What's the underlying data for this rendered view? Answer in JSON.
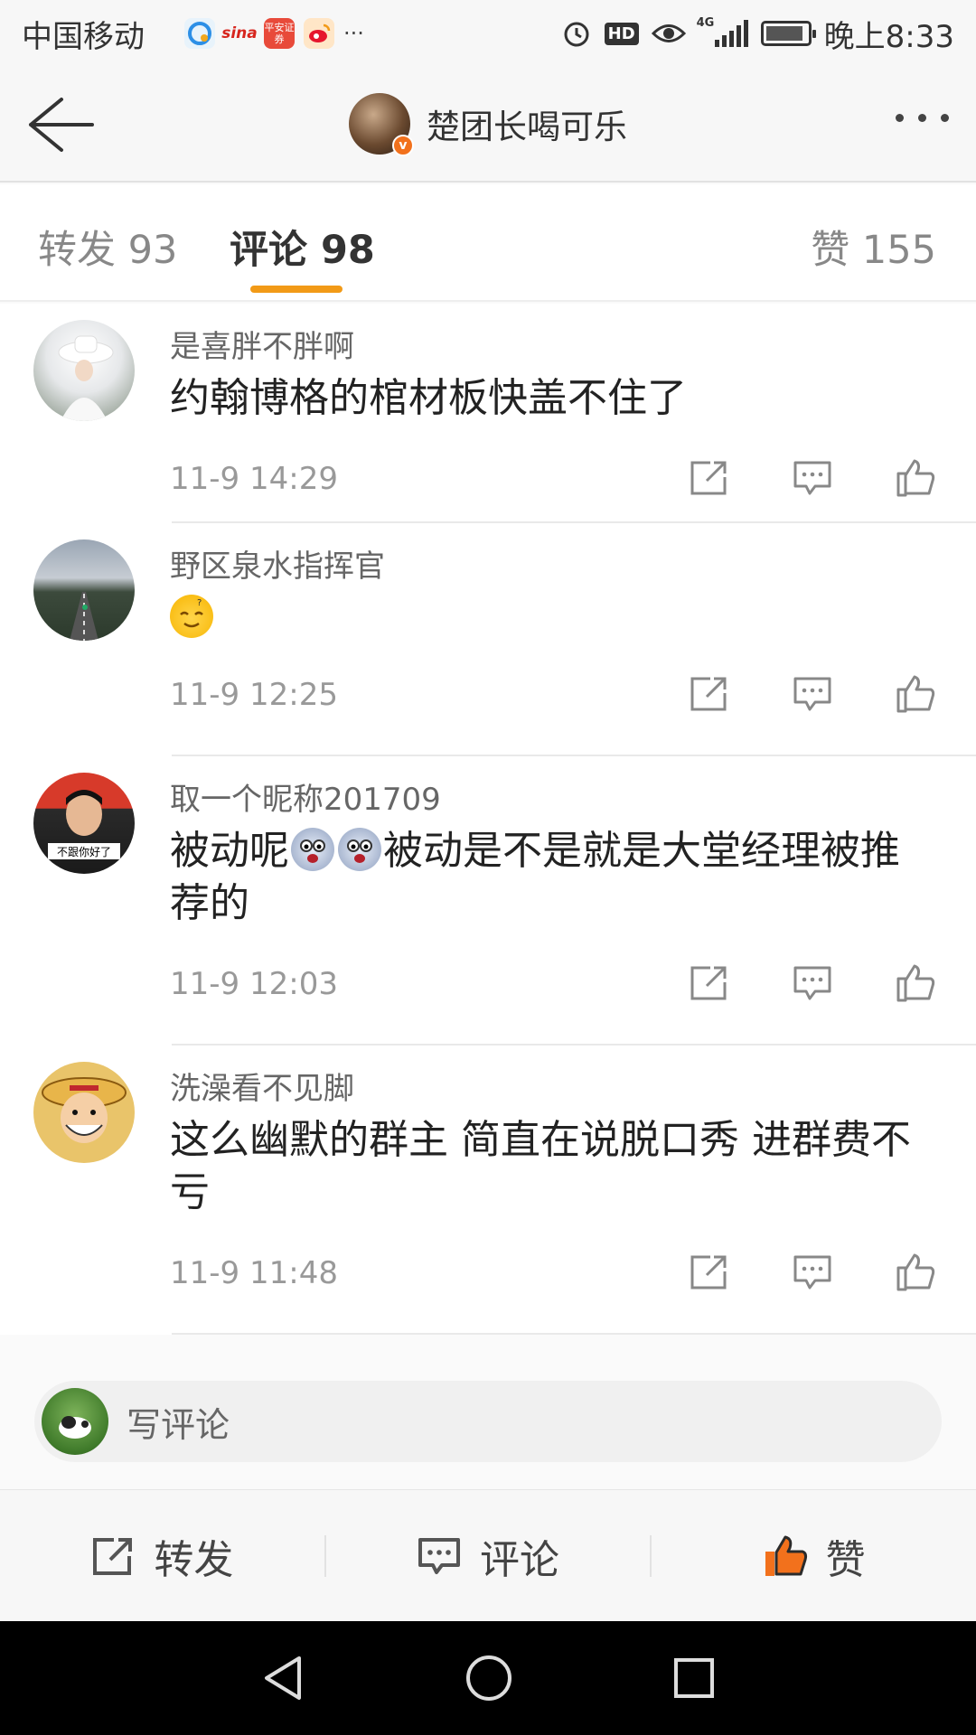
{
  "status_bar": {
    "carrier": "中国移动",
    "app_badges": [
      "平安证券"
    ],
    "more": "···",
    "hd": "HD",
    "network": "4G",
    "time": "晚上8:33"
  },
  "header": {
    "title": "楚团长喝可乐",
    "verified_badge": "v"
  },
  "tabs": {
    "forward": "转发 93",
    "comment": "评论 98",
    "like": "赞 155",
    "active": "comment",
    "accent_color": "#f29a17"
  },
  "comments": [
    {
      "user": "是喜胖不胖啊",
      "text": "约翰博格的棺材板快盖不住了",
      "time": "11-9 14:29"
    },
    {
      "user": "野区泉水指挥官",
      "text": "",
      "emoji": "dizzy-emoji",
      "time": "11-9 12:25"
    },
    {
      "user": "取一个昵称201709",
      "text_parts": [
        "被动呢",
        "被动是不是就是大堂经理被推荐的"
      ],
      "emojis": [
        "panic-emoji",
        "panic-emoji"
      ],
      "avatar_caption": "不跟你好了",
      "time": "11-9 12:03"
    },
    {
      "user": "洗澡看不见脚",
      "text": "这么幽默的群主 简直在说脱口秀 进群费不亏",
      "time": "11-9 11:48"
    }
  ],
  "write_comment": {
    "placeholder": "写评论"
  },
  "action_bar": {
    "forward": "转发",
    "comment": "评论",
    "like": "赞",
    "like_color": "#f2711c"
  },
  "icons": [
    "back-arrow-icon",
    "more-icon",
    "share-icon",
    "comment-icon",
    "like-icon",
    "alarm-icon",
    "eye-icon",
    "signal-icon",
    "battery-icon"
  ]
}
